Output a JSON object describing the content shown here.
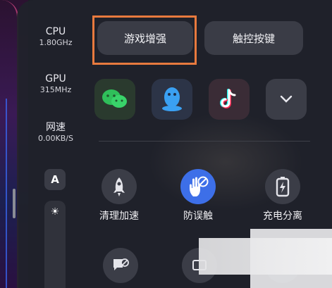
{
  "stats": {
    "cpu": {
      "label": "CPU",
      "value": "1.80GHz"
    },
    "gpu": {
      "label": "GPU",
      "value": "315MHz"
    },
    "net": {
      "label": "网速",
      "value": "0.00KB/S"
    }
  },
  "side": {
    "a_label": "A"
  },
  "top_buttons": {
    "game_boost": "游戏增强",
    "touch_keys": "触控按键"
  },
  "apps": [
    "wechat",
    "qq",
    "tiktok",
    "more"
  ],
  "tools": {
    "clean": "清理加速",
    "anti_touch": "防误触",
    "charge_split": "充电分离"
  },
  "colors": {
    "highlight": "#e87a3e",
    "accent_blue": "#3d6fe8",
    "wechat": "#2fbf5a"
  }
}
